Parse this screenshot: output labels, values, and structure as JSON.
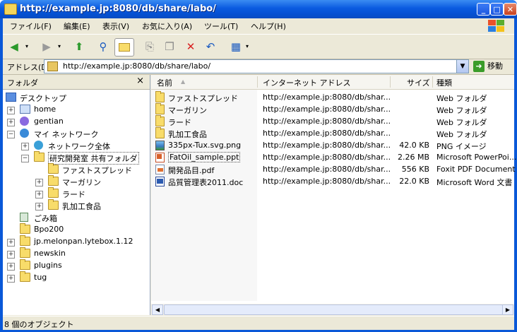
{
  "window": {
    "title": "http://example.jp:8080/db/share/labo/"
  },
  "menu": [
    "ファイル(F)",
    "編集(E)",
    "表示(V)",
    "お気に入り(A)",
    "ツール(T)",
    "ヘルプ(H)"
  ],
  "address": {
    "label": "アドレス(D)",
    "value": "http://example.jp:8080/db/share/labo/",
    "go_label": "移動"
  },
  "folder_pane": {
    "title": "フォルダ",
    "close": "×",
    "tree": [
      {
        "label": "デスクトップ",
        "expander": ""
      },
      {
        "label": "home",
        "expander": "+"
      },
      {
        "label": "gentian",
        "expander": "+"
      },
      {
        "label": "マイ ネットワーク",
        "expander": "−"
      },
      {
        "label": "ネットワーク全体",
        "expander": "+"
      },
      {
        "label": "研究開発室 共有フォルダ",
        "expander": "−"
      },
      {
        "label": "ファストスプレッド",
        "expander": ""
      },
      {
        "label": "マーガリン",
        "expander": "+"
      },
      {
        "label": "ラード",
        "expander": "+"
      },
      {
        "label": "乳加工食品",
        "expander": "+"
      },
      {
        "label": "ごみ箱",
        "expander": ""
      },
      {
        "label": "Bpo200",
        "expander": ""
      },
      {
        "label": "jp.melonpan.lytebox.1.12",
        "expander": "+"
      },
      {
        "label": "newskin",
        "expander": "+"
      },
      {
        "label": "plugins",
        "expander": "+"
      },
      {
        "label": "tug",
        "expander": "+"
      }
    ]
  },
  "list": {
    "columns": [
      "名前",
      "インターネット アドレス",
      "サイズ",
      "種類"
    ],
    "rows": [
      {
        "name": "ファストスプレッド",
        "url": "http://example.jp:8080/db/shar...",
        "size": "",
        "type": "Web フォルダ",
        "icon": "folder-icon"
      },
      {
        "name": "マーガリン",
        "url": "http://example.jp:8080/db/shar...",
        "size": "",
        "type": "Web フォルダ",
        "icon": "folder-icon"
      },
      {
        "name": "ラード",
        "url": "http://example.jp:8080/db/shar...",
        "size": "",
        "type": "Web フォルダ",
        "icon": "folder-icon"
      },
      {
        "name": "乳加工食品",
        "url": "http://example.jp:8080/db/shar...",
        "size": "",
        "type": "Web フォルダ",
        "icon": "folder-icon"
      },
      {
        "name": "335px-Tux.svg.png",
        "url": "http://example.jp:8080/db/shar...",
        "size": "42.0 KB",
        "type": "PNG イメージ",
        "icon": "image-file-icon"
      },
      {
        "name": "FatOil_sample.ppt",
        "url": "http://example.jp:8080/db/shar...",
        "size": "2.26 MB",
        "type": "Microsoft PowerPoi...",
        "icon": "powerpoint-file-icon"
      },
      {
        "name": "開発品目.pdf",
        "url": "http://example.jp:8080/db/shar...",
        "size": "556 KB",
        "type": "Foxit PDF Document",
        "icon": "pdf-file-icon"
      },
      {
        "name": "品質管理表2011.doc",
        "url": "http://example.jp:8080/db/shar...",
        "size": "22.0 KB",
        "type": "Microsoft Word 文書",
        "icon": "word-file-icon"
      }
    ]
  },
  "status": {
    "text": "8 個のオブジェクト"
  }
}
